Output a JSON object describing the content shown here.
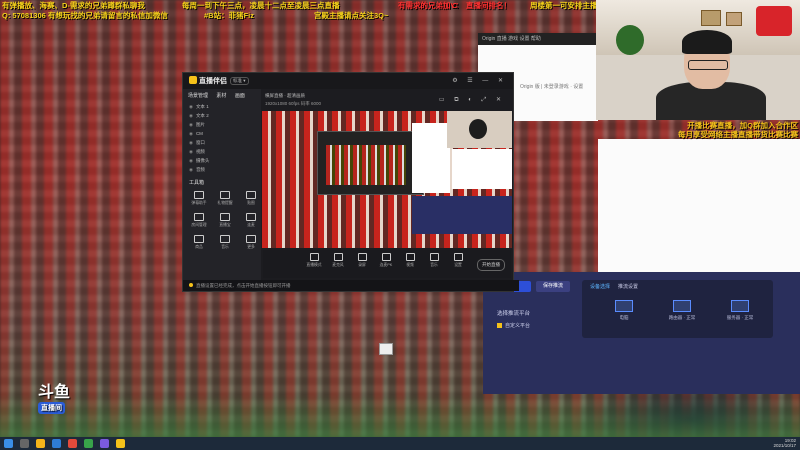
{
  "overlay": {
    "line1_left": "有弹播放、海赛、D-需求的兄弟蹲群私聊我",
    "line1_mid": "每周一到下午三点，凌晨十二点至凌晨三点直播",
    "line1_right_a": "有需求的兄弟加V：",
    "line1_right_b": "C",
    "line1_right_c": "直播间排名！",
    "line1_right_d": "周楼第一可安排主播周赛阵容！包括国服、高端肿痕、肤色、姓氏、发型等",
    "line2_left": "Q: 57081306   有想玩找的兄弟请留言的私信加微信",
    "line2_tag": "#B站：菲猪Fiz",
    "line2_mid": "宫殿主播请点关注3Q~",
    "cam_caption_1": "开播比赛直播，加Q群加入合作区",
    "cam_caption_2": "每月享受网络主播直播带货比赛比赛"
  },
  "whitepane": {
    "tabs": "Origin   直播   游戏   设置   帮助",
    "hint": "Origin 版 | 未登录游戏 · 设置"
  },
  "window": {
    "app_name": "直播伴侣",
    "version": "标准 ▾",
    "titlebar_icons": "⚙ ☰ — ✕",
    "sidebar_tabs": [
      "场景管理",
      "素材",
      "画面"
    ],
    "sources": [
      "文本 1",
      "文本 2",
      "图片",
      "CM",
      "窗口",
      "视频",
      "摄像头",
      "音频"
    ],
    "tools_title": "工具箱",
    "tools": [
      "弹幕助手",
      "礼物提醒",
      "贴图",
      "房间管理",
      "直播宝",
      "连麦",
      "商品",
      "音乐",
      "更多"
    ],
    "main_title": "横屏直播 · 超清画质",
    "main_sub": "1920x1080  60fps  码率 6000",
    "main_controls": "▭ ⧉ ◐ ⤢ ✕",
    "bottom_tools": [
      "直播模式",
      "麦克风",
      "录屏",
      "连麦PK",
      "视频",
      "音乐",
      "设置"
    ],
    "start_button": "开始直播",
    "status": "直播设置已经完成，点击开始直播按钮即可开播"
  },
  "right_panel": {
    "btn_a": "确定",
    "btn_b": "保存推流",
    "tab_on": "设备选择",
    "tab_off": "推流设置",
    "devices": [
      "电脑",
      "路由器 · 正常",
      "服务器 · 正常"
    ],
    "platform": "选择推流平台",
    "check_label": "自定义平台"
  },
  "brand": {
    "logo_top": "斗鱼",
    "logo_bottom": "直播间"
  },
  "taskbar": {
    "time": "19:02",
    "date": "2021/10/17"
  },
  "colors": {
    "marquee_gold": "#f5d21a",
    "marquee_red": "#ff3030",
    "panel_purple": "#2a2f5c",
    "accent_blue": "#5db6ff"
  }
}
